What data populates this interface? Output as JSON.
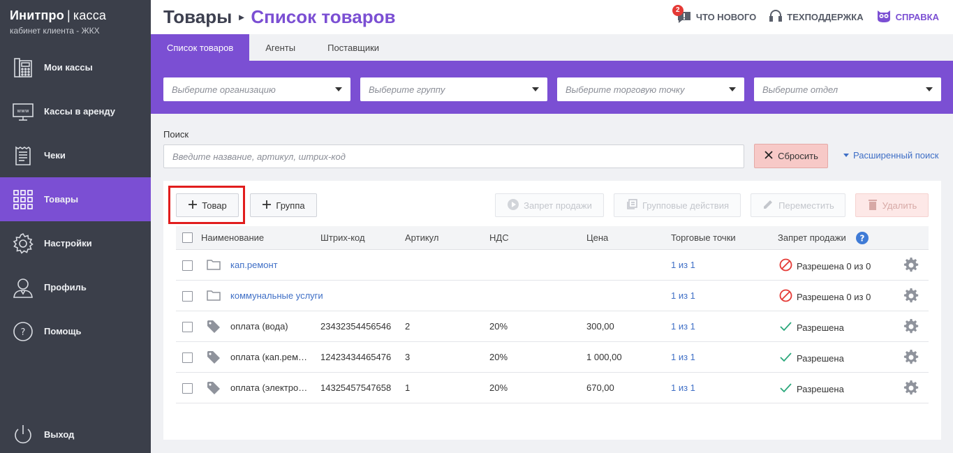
{
  "brand": {
    "name": "Инитпро",
    "separator": "|",
    "product": "касса",
    "subtitle": "кабинет клиента - ЖКХ"
  },
  "sidebar": {
    "items": [
      {
        "label": "Мои кассы",
        "icon": "cash-register-icon"
      },
      {
        "label": "Кассы в аренду",
        "icon": "www-monitor-icon"
      },
      {
        "label": "Чеки",
        "icon": "receipt-icon"
      },
      {
        "label": "Товары",
        "icon": "grid-icon",
        "active": true
      },
      {
        "label": "Настройки",
        "icon": "gear-icon"
      },
      {
        "label": "Профиль",
        "icon": "user-icon"
      },
      {
        "label": "Помощь",
        "icon": "question-icon"
      },
      {
        "label": "Выход",
        "icon": "power-icon"
      }
    ]
  },
  "header": {
    "crumb_root": "Товары",
    "crumb_current": "Список товаров",
    "news": {
      "label": "ЧТО НОВОГО",
      "badge": "2"
    },
    "support": {
      "label": "ТЕХПОДДЕРЖКА"
    },
    "help": {
      "label": "СПРАВКА"
    }
  },
  "tabs": [
    {
      "label": "Список товаров",
      "active": true
    },
    {
      "label": "Агенты"
    },
    {
      "label": "Поставщики"
    }
  ],
  "filters": {
    "organization": "Выберите организацию",
    "group": "Выберите группу",
    "point": "Выберите торговую точку",
    "department": "Выберите отдел"
  },
  "search": {
    "label": "Поиск",
    "placeholder": "Введите название, артикул, штрих-код",
    "reset": "Сбросить",
    "advanced": "Расширенный поиск"
  },
  "toolbar": {
    "add_product": "Товар",
    "add_group": "Группа",
    "ban_sale": "Запрет продажи",
    "group_actions": "Групповые действия",
    "move": "Переместить",
    "delete": "Удалить"
  },
  "table": {
    "headers": {
      "name": "Наименование",
      "barcode": "Штрих-код",
      "sku": "Артикул",
      "vat": "НДС",
      "price": "Цена",
      "points": "Торговые точки",
      "ban": "Запрет продажи"
    },
    "rows": [
      {
        "type": "folder",
        "name": "кап.ремонт",
        "barcode": "",
        "sku": "",
        "vat": "",
        "price": "",
        "points": "1 из 1",
        "status": "Разрешена 0 из 0",
        "status_kind": "blocked"
      },
      {
        "type": "folder",
        "name": "коммунальные услуги",
        "barcode": "",
        "sku": "",
        "vat": "",
        "price": "",
        "points": "1 из 1",
        "status": "Разрешена 0 из 0",
        "status_kind": "blocked"
      },
      {
        "type": "product",
        "name": "оплата (вода)",
        "barcode": "23432354456546",
        "sku": "2",
        "vat": "20%",
        "price": "300,00",
        "points": "1 из 1",
        "status": "Разрешена",
        "status_kind": "allowed"
      },
      {
        "type": "product",
        "name": "оплата (кап.рем…",
        "barcode": "12423434465476",
        "sku": "3",
        "vat": "20%",
        "price": "1 000,00",
        "points": "1 из 1",
        "status": "Разрешена",
        "status_kind": "allowed"
      },
      {
        "type": "product",
        "name": "оплата (электро…",
        "barcode": "14325457547658",
        "sku": "1",
        "vat": "20%",
        "price": "670,00",
        "points": "1 из 1",
        "status": "Разрешена",
        "status_kind": "allowed"
      }
    ]
  },
  "colors": {
    "accent": "#7b4fd3",
    "sidebar": "#3b3f4a",
    "link": "#3f6fc6",
    "danger": "#e53935",
    "ok": "#2aa77a"
  }
}
